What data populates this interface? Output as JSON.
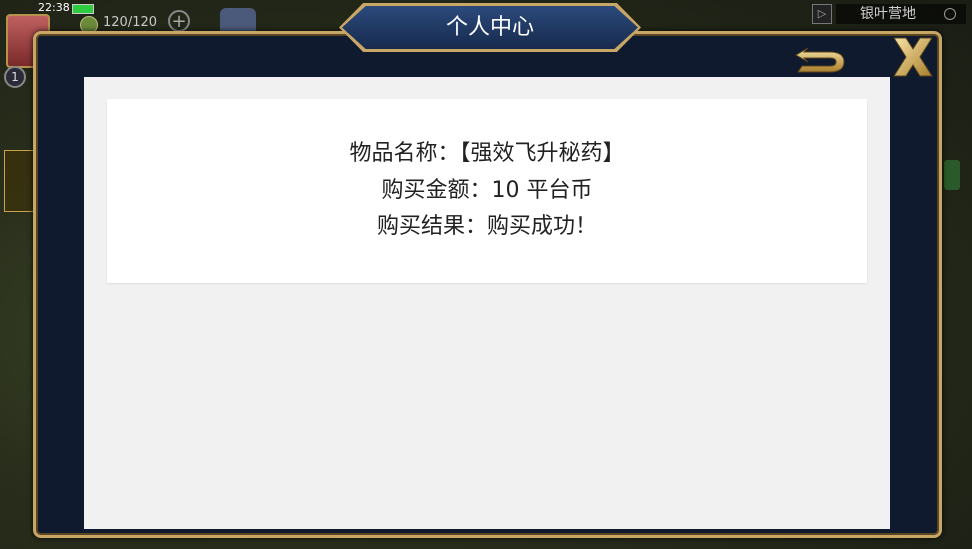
{
  "hud": {
    "time": "22:38",
    "stamina": "120/120",
    "plus": "+",
    "level": "1",
    "map_button": "▷",
    "location": "银叶营地"
  },
  "dialog": {
    "title": "个人中心",
    "lines": [
      "物品名称：【强效飞升秘药】",
      "购买金额：10 平台币",
      "购买结果：购买成功！"
    ]
  },
  "colors": {
    "frame_gold": "#c8a766",
    "frame_navy": "#0f1a2e",
    "panel_bg": "#f1f1f1",
    "card_bg": "#ffffff"
  },
  "icons": [
    "back-arrow-icon",
    "close-x-icon",
    "battery-icon",
    "stamina-icon",
    "search-icon"
  ]
}
